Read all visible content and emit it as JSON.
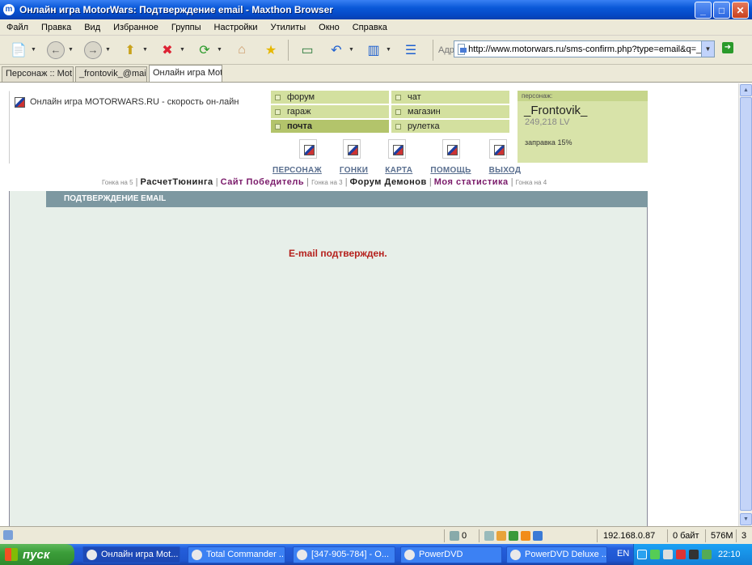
{
  "window": {
    "title": "Онлайн игра MotorWars: Подтверждение email - Maxthon Browser",
    "buttons": {
      "minimize": "_",
      "maximize": "□",
      "close": "✕"
    }
  },
  "menu": [
    "Файл",
    "Правка",
    "Вид",
    "Избранное",
    "Группы",
    "Настройки",
    "Утилиты",
    "Окно",
    "Справка"
  ],
  "address": {
    "label": "Адрес",
    "url": "http://www.motorwars.ru/sms-confirm.php?type=email&q=_Frc"
  },
  "tabs": [
    {
      "label": "Персонаж :: Mot..."
    },
    {
      "label": "_frontovik_@mail...."
    },
    {
      "label": "Онлайн игра Mot..."
    }
  ],
  "site": {
    "logo_text": "Онлайн игра MOTORWARS.RU - скорость он-лайн",
    "nav_left": [
      "форум",
      "гараж",
      "почта"
    ],
    "nav_right": [
      "чат",
      "магазин",
      "рулетка"
    ],
    "character": {
      "header": "персонаж:",
      "name": "_Frontovik_",
      "level": "249,218 LV",
      "fuel": "заправка 15%"
    },
    "main_links": [
      "ПЕРСОНАЖ",
      "ГОНКИ",
      "КАРТА",
      "ПОМОЩЬ",
      "ВЫХОД"
    ],
    "sub_links": {
      "race5": "Гонка на 5",
      "tuning": "РасчетТюнинга",
      "winner": "Сайт Победитель",
      "race3": "Гонка на 3",
      "forum": "Форум Демонов",
      "stats": "Моя статистика",
      "race4": "Гонка на 4"
    },
    "section_title": "ПОДТВЕРЖДЕНИЕ EMAIL",
    "message": "E-mail подтвержден."
  },
  "statusbar": {
    "count": "0",
    "ip": "192.168.0.87",
    "traffic": "0 байт",
    "memory": "576M",
    "tabs_count": "3"
  },
  "taskbar": {
    "start": "пуск",
    "tasks": [
      "Онлайн игра Mot...",
      "Total Commander ...",
      "[347-905-784] - O...",
      "PowerDVD",
      "PowerDVD Deluxe ..."
    ],
    "lang": "EN",
    "clock": "22:10"
  }
}
